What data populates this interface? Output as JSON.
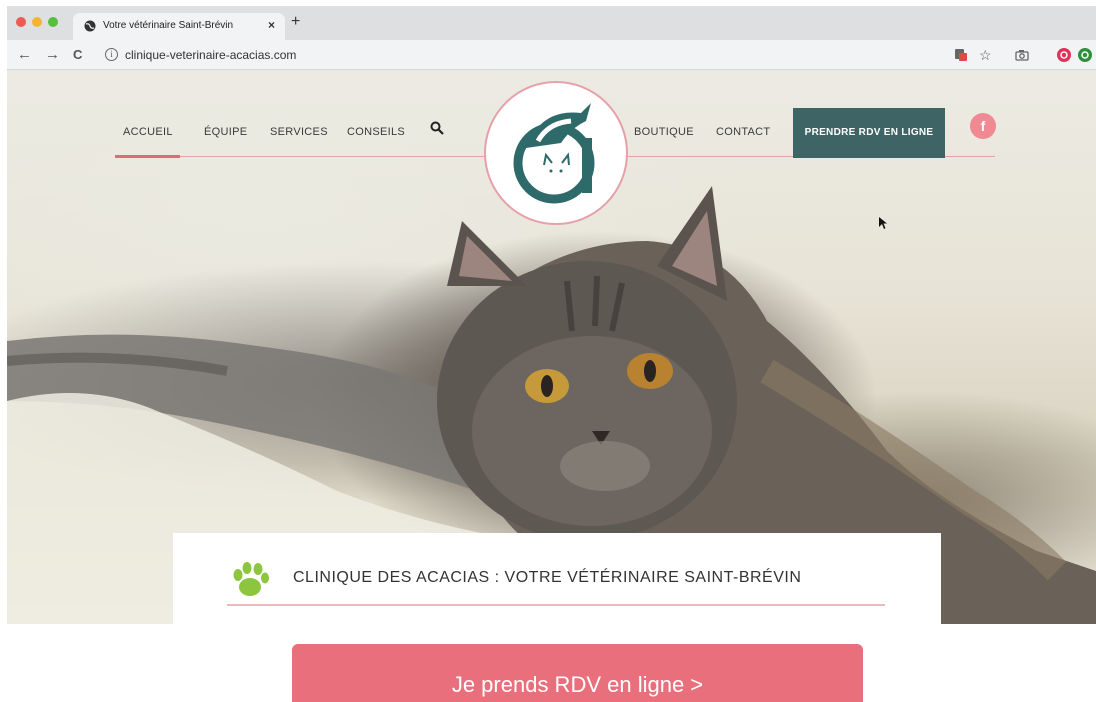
{
  "browser": {
    "tab_title": "Votre vétérinaire Saint-Brévin",
    "tab_close": "×",
    "new_tab": "+",
    "url": "clinique-veterinaire-acacias.com",
    "nav_back": "←",
    "nav_forward": "→",
    "nav_reload": "C",
    "url_info": "i",
    "star": "☆"
  },
  "site": {
    "nav": {
      "accueil": "ACCUEIL",
      "equipe": "ÉQUIPE",
      "services": "SERVICES",
      "conseils": "CONSEILS",
      "boutique": "BOUTIQUE",
      "contact": "CONTACT",
      "rdv": "PRENDRE RDV EN LIGNE",
      "facebook": "f"
    },
    "hero_title": "CLINIQUE DES ACACIAS : VOTRE VÉTÉRINAIRE SAINT-BRÉVIN",
    "colors": {
      "accent_pink": "#e96f7c",
      "nav_button": "#3e6466",
      "paw_green": "#8cc63f"
    }
  },
  "cta": {
    "label": "Je prends RDV en ligne >"
  }
}
